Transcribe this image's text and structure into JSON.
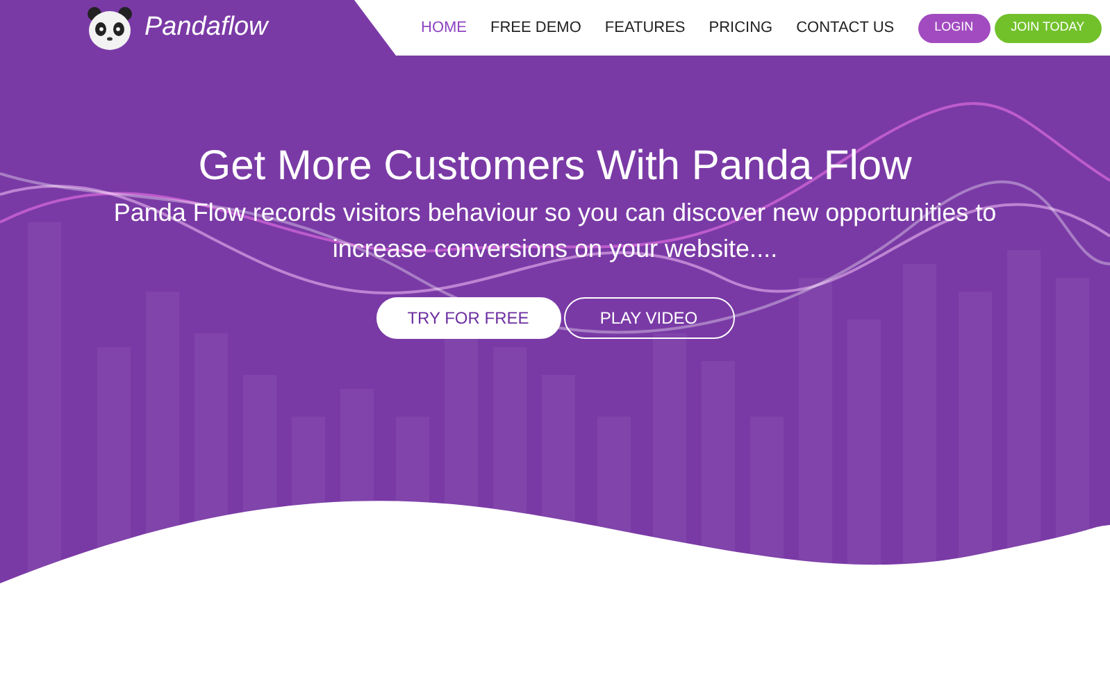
{
  "logo": {
    "text": "Pandaflow"
  },
  "nav": [
    {
      "label": "HOME",
      "selected": true
    },
    {
      "label": "FREE DEMO",
      "selected": false
    },
    {
      "label": "FEATURES",
      "selected": false
    },
    {
      "label": "PRICING",
      "selected": false
    },
    {
      "label": "CONTACT US",
      "selected": false
    }
  ],
  "nav_buttons": [
    {
      "label": "LOGIN",
      "kind": "login"
    },
    {
      "label": "JOIN TODAY",
      "kind": "join"
    }
  ],
  "hero": {
    "title": "Get More Customers With Panda Flow",
    "subtitle": "Panda Flow records visitors behaviour so you can discover new opportunities to increase conversions on your website....",
    "buttons": [
      {
        "label": "TRY FOR FREE",
        "kind": "solid"
      },
      {
        "label": "PLAY VIDEO",
        "kind": "outline"
      }
    ]
  }
}
